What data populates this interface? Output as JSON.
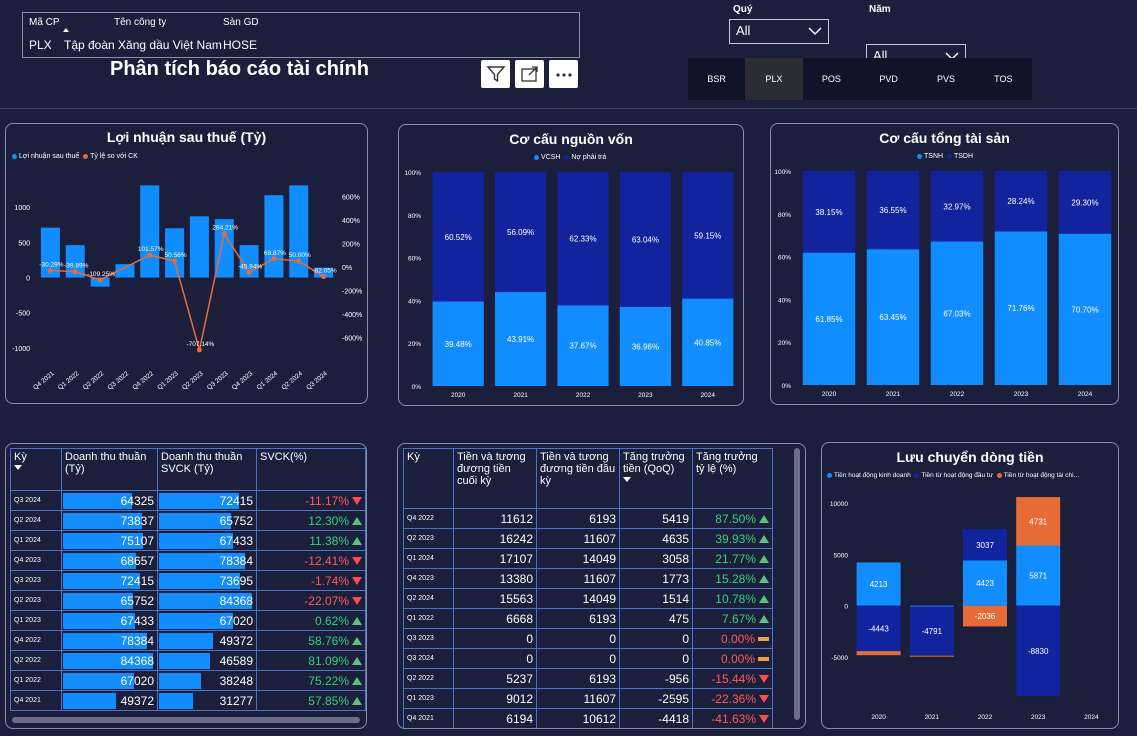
{
  "company_table": {
    "headers": [
      "Mã CP",
      "Tên công ty",
      "Sàn GD"
    ],
    "row": [
      "PLX",
      "Tập đoàn Xăng dầu Việt Nam",
      "HOSE"
    ]
  },
  "title": "Phân tích báo cáo tài chính",
  "filters": {
    "quarter_label": "Quý",
    "quarter_value": "All",
    "year_label": "Năm",
    "year_value": "All"
  },
  "tabs": [
    "BSR",
    "PLX",
    "POS",
    "PVD",
    "PVS",
    "TOS"
  ],
  "active_tab": "PLX",
  "colors": {
    "blue": "#118dff",
    "navy": "#12239e",
    "orange": "#e66c37",
    "green": "#35d07f",
    "red": "#ff5a5a"
  },
  "icons": [
    "filter-icon",
    "focus-mode-icon",
    "more-options-icon"
  ],
  "profit_chart": {
    "title": "Lợi nhuận sau thuế (Tỷ)",
    "legend": [
      "Lợi nhuận sau thuế",
      "Tỷ lệ so với CK"
    ]
  },
  "capital_chart": {
    "title": "Cơ cấu nguồn vốn",
    "legend": [
      "VCSH",
      "Nợ phải trả"
    ]
  },
  "assets_chart": {
    "title": "Cơ cấu tổng tài sản",
    "legend": [
      "TSNH",
      "TSDH"
    ]
  },
  "cashflow_chart": {
    "title": "Lưu chuyển dòng tiền",
    "legend": [
      "Tiền hoạt động kinh doanh",
      "Tiền từ hoạt động đầu tư",
      "Tiền từ hoạt động tài chi..."
    ]
  },
  "chart_data": [
    {
      "type": "bar",
      "title": "Lợi nhuận sau thuế (Tỷ)",
      "categories": [
        "Q4 2021",
        "Q1 2022",
        "Q2 2022",
        "Q3 2022",
        "Q4 2022",
        "Q1 2023",
        "Q2 2023",
        "Q3 2023",
        "Q4 2023",
        "Q1 2024",
        "Q2 2024",
        "Q3 2024"
      ],
      "series": [
        {
          "name": "Lợi nhuận sau thuế",
          "type": "bar",
          "values": [
            710,
            460,
            -130,
            190,
            1310,
            700,
            870,
            830,
            460,
            1170,
            1310,
            140
          ]
        },
        {
          "name": "Tỷ lệ so với CK",
          "type": "line",
          "axis": "right",
          "values": [
            -30.29,
            -39.89,
            -109.25,
            null,
            101.57,
            50.56,
            -707.14,
            284.21,
            -45.94,
            69.87,
            50.0,
            -82.05
          ],
          "labels": [
            "-30.29%",
            "-39.89%",
            "-109.25%",
            "",
            "101.57%",
            "50.56%",
            "-707.14%",
            "284.21%",
            "-45.94%",
            "69.87%",
            "50.00%",
            "-82.05%"
          ]
        }
      ],
      "yticks_left": [
        "1000",
        "500",
        "0",
        "-500",
        "-1000"
      ],
      "ylim_left": [
        -1200,
        1500
      ],
      "yticks_right": [
        "600%",
        "400%",
        "200%",
        "0%",
        "-200%",
        "-400%",
        "-600%"
      ],
      "ylim_right": [
        -810,
        810
      ]
    },
    {
      "type": "bar",
      "stacked": true,
      "title": "Cơ cấu nguồn vốn",
      "categories": [
        "2020",
        "2021",
        "2022",
        "2023",
        "2024"
      ],
      "series": [
        {
          "name": "VCSH",
          "values": [
            39.48,
            43.91,
            37.67,
            36.96,
            40.85
          ],
          "labels": [
            "39.48%",
            "43.91%",
            "37.67%",
            "36.96%",
            "40.85%"
          ]
        },
        {
          "name": "Nợ phải trả",
          "values": [
            60.52,
            56.09,
            62.33,
            63.04,
            59.15
          ],
          "labels": [
            "60.52%",
            "56.09%",
            "62.33%",
            "63.04%",
            "59.15%"
          ]
        }
      ],
      "yticks": [
        "100%",
        "80%",
        "60%",
        "40%",
        "20%",
        "0%"
      ]
    },
    {
      "type": "bar",
      "stacked": true,
      "title": "Cơ cấu tổng tài sản",
      "categories": [
        "2020",
        "2021",
        "2022",
        "2023",
        "2024"
      ],
      "series": [
        {
          "name": "TSNH",
          "values": [
            61.85,
            63.45,
            67.03,
            71.76,
            70.7
          ],
          "labels": [
            "61.85%",
            "63.45%",
            "67.03%",
            "71.76%",
            "70.70%"
          ]
        },
        {
          "name": "TSDH",
          "values": [
            38.15,
            36.55,
            32.97,
            28.24,
            29.3
          ],
          "labels": [
            "38.15%",
            "36.55%",
            "32.97%",
            "28.24%",
            "29.30%"
          ]
        }
      ],
      "yticks": [
        "100%",
        "80%",
        "60%",
        "40%",
        "20%",
        "0%"
      ]
    },
    {
      "type": "bar",
      "stacked": true,
      "title": "Lưu chuyển dòng tiền",
      "categories": [
        "2020",
        "2021",
        "2022",
        "2023",
        "2024"
      ],
      "series": [
        {
          "name": "Tiền hoạt động kinh doanh",
          "values": [
            4213,
            -100,
            4423,
            5871,
            null
          ],
          "labels": [
            "4213",
            "",
            "4423",
            "5871",
            ""
          ]
        },
        {
          "name": "Tiền từ hoạt động đầu tư",
          "values": [
            -4443,
            -4791,
            3037,
            -8830,
            null
          ],
          "labels": [
            "-4443",
            "-4791",
            "3037",
            "-8830",
            ""
          ]
        },
        {
          "name": "Tiền từ hoạt động tài chi...",
          "values": [
            -400,
            -100,
            -2036,
            4731,
            null
          ],
          "labels": [
            "",
            "",
            "-2036",
            "4731",
            ""
          ]
        }
      ],
      "yticks": [
        "10000",
        "5000",
        "0",
        "-5000"
      ],
      "ylim": [
        -10000,
        11000
      ]
    }
  ],
  "revenue_table": {
    "headers": [
      "Kỳ",
      "Doanh thu thuần (Tỷ)",
      "Doanh thu thuần SVCK (Tỷ)",
      "SVCK(%)"
    ],
    "max": 84368,
    "rows": [
      {
        "k": "Q3 2024",
        "dt": "64325",
        "dt_v": 64325,
        "sv": "72415",
        "sv_v": 72415,
        "pct": "-11.17%",
        "dir": "down"
      },
      {
        "k": "Q2 2024",
        "dt": "73837",
        "dt_v": 73837,
        "sv": "65752",
        "sv_v": 65752,
        "pct": "12.30%",
        "dir": "up"
      },
      {
        "k": "Q1 2024",
        "dt": "75107",
        "dt_v": 75107,
        "sv": "67433",
        "sv_v": 67433,
        "pct": "11.38%",
        "dir": "up"
      },
      {
        "k": "Q4 2023",
        "dt": "68657",
        "dt_v": 68657,
        "sv": "78384",
        "sv_v": 78384,
        "pct": "-12.41%",
        "dir": "down"
      },
      {
        "k": "Q3 2023",
        "dt": "72415",
        "dt_v": 72415,
        "sv": "73695",
        "sv_v": 73695,
        "pct": "-1.74%",
        "dir": "down"
      },
      {
        "k": "Q2 2023",
        "dt": "65752",
        "dt_v": 65752,
        "sv": "84368",
        "sv_v": 84368,
        "pct": "-22.07%",
        "dir": "down"
      },
      {
        "k": "Q1 2023",
        "dt": "67433",
        "dt_v": 67433,
        "sv": "67020",
        "sv_v": 67020,
        "pct": "0.62%",
        "dir": "up"
      },
      {
        "k": "Q4 2022",
        "dt": "78384",
        "dt_v": 78384,
        "sv": "49372",
        "sv_v": 49372,
        "pct": "58.76%",
        "dir": "up"
      },
      {
        "k": "Q2 2022",
        "dt": "84368",
        "dt_v": 84368,
        "sv": "46589",
        "sv_v": 46589,
        "pct": "81.09%",
        "dir": "up"
      },
      {
        "k": "Q1 2022",
        "dt": "67020",
        "dt_v": 67020,
        "sv": "38248",
        "sv_v": 38248,
        "pct": "75.22%",
        "dir": "up"
      },
      {
        "k": "Q4 2021",
        "dt": "49372",
        "dt_v": 49372,
        "sv": "31277",
        "sv_v": 31277,
        "pct": "57.85%",
        "dir": "up"
      }
    ]
  },
  "cash_table": {
    "headers": [
      "Kỳ",
      "Tiền và tương đương tiền cuối kỳ",
      "Tiền và tương đương tiền đầu kỳ",
      "Tăng trưởng tiền (QoQ)",
      "Tăng trưởng tỷ lệ (%)"
    ],
    "rows": [
      {
        "k": "Q4 2022",
        "a": "11612",
        "b": "6193",
        "c": "5419",
        "pct": "87.50%",
        "dir": "up"
      },
      {
        "k": "Q2 2023",
        "a": "16242",
        "b": "11607",
        "c": "4635",
        "pct": "39.93%",
        "dir": "up"
      },
      {
        "k": "Q1 2024",
        "a": "17107",
        "b": "14049",
        "c": "3058",
        "pct": "21.77%",
        "dir": "up"
      },
      {
        "k": "Q4 2023",
        "a": "13380",
        "b": "11607",
        "c": "1773",
        "pct": "15.28%",
        "dir": "up"
      },
      {
        "k": "Q2 2024",
        "a": "15563",
        "b": "14049",
        "c": "1514",
        "pct": "10.78%",
        "dir": "up"
      },
      {
        "k": "Q1 2022",
        "a": "6668",
        "b": "6193",
        "c": "475",
        "pct": "7.67%",
        "dir": "up"
      },
      {
        "k": "Q3 2023",
        "a": "0",
        "b": "0",
        "c": "0",
        "pct": "0.00%",
        "dir": "flat"
      },
      {
        "k": "Q3 2024",
        "a": "0",
        "b": "0",
        "c": "0",
        "pct": "0.00%",
        "dir": "flat"
      },
      {
        "k": "Q2 2022",
        "a": "5237",
        "b": "6193",
        "c": "-956",
        "pct": "-15.44%",
        "dir": "down"
      },
      {
        "k": "Q1 2023",
        "a": "9012",
        "b": "11607",
        "c": "-2595",
        "pct": "-22.36%",
        "dir": "down"
      },
      {
        "k": "Q4 2021",
        "a": "6194",
        "b": "10612",
        "c": "-4418",
        "pct": "-41.63%",
        "dir": "down"
      }
    ]
  }
}
